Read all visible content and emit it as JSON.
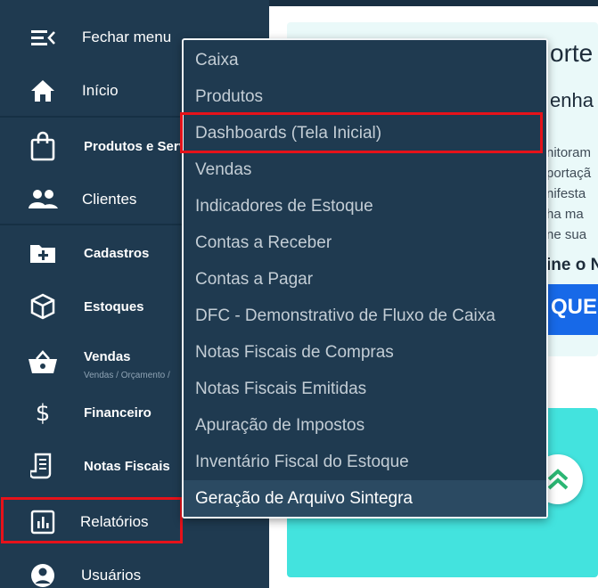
{
  "sidebar": {
    "close_menu": "Fechar menu",
    "items": [
      {
        "label": "Início"
      },
      {
        "label": "Produtos e Serviços"
      },
      {
        "label": "Clientes"
      },
      {
        "label": "Cadastros"
      },
      {
        "label": "Estoques"
      },
      {
        "label": "Vendas",
        "sub": "Vendas / Orçamento /"
      },
      {
        "label": "Financeiro"
      },
      {
        "label": "Notas Fiscais"
      },
      {
        "label": "Relatórios"
      },
      {
        "label": "Usuários"
      }
    ]
  },
  "dropdown": {
    "items": [
      "Caixa",
      "Produtos",
      "Dashboards (Tela Inicial)",
      "Vendas",
      "Indicadores de Estoque",
      "Contas a Receber",
      "Contas a Pagar",
      "DFC - Demonstrativo de Fluxo de Caixa",
      "Notas Fiscais de Compras",
      "Notas Fiscais Emitidas",
      "Apuração de Impostos",
      "Inventário Fiscal do Estoque",
      "Geração de Arquivo Sintegra"
    ]
  },
  "content": {
    "title": "orte",
    "subtitle": "enha n",
    "lines": [
      "nitoram",
      "portaçã",
      "nifesta",
      "ha ma",
      "ne sua"
    ],
    "bold_line": "ine o N",
    "cta": "QUE"
  },
  "colors": {
    "sidebar_bg": "#1f3a50",
    "highlight_red": "#e6121a",
    "cta_blue": "#1769e8",
    "card_teal": "#43e3de"
  }
}
